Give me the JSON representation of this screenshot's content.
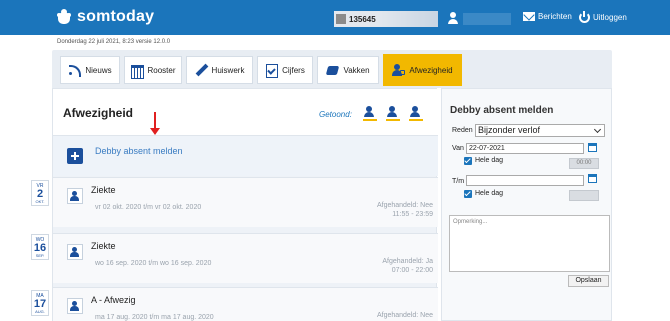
{
  "app": {
    "brand": "somtoday"
  },
  "topbar": {
    "student_number": "135645",
    "messages_label": "Berichten",
    "logout_label": "Uitloggen",
    "icons": {
      "messages": "envelope-icon",
      "logout": "power-icon",
      "user": "user-icon"
    }
  },
  "dateline": "Donderdag 22 juli 2021, 8:23 versie 12.0.0",
  "tabs": [
    {
      "label": "Nieuws",
      "icon": "rss-icon"
    },
    {
      "label": "Rooster",
      "icon": "calendar-icon"
    },
    {
      "label": "Huiswerk",
      "icon": "pen-icon"
    },
    {
      "label": "Cijfers",
      "icon": "checklist-icon"
    },
    {
      "label": "Vakken",
      "icon": "books-icon"
    },
    {
      "label": "Afwezigheid",
      "icon": "person-badge-icon",
      "active": true
    }
  ],
  "main": {
    "title": "Afwezigheid",
    "filter_label": "Getoond:",
    "add_label": "Debby absent melden",
    "items": [
      {
        "title": "Ziekte",
        "period": "vr 02 okt. 2020 t/m vr 02 okt. 2020",
        "status": "Afgehandeld: Nee",
        "time": "11:55 - 23:59",
        "date": {
          "dow": "VR",
          "day": "2",
          "mon": "OKT."
        }
      },
      {
        "title": "Ziekte",
        "period": "wo 16 sep. 2020 t/m wo 16 sep. 2020",
        "status": "Afgehandeld: Ja",
        "time": "07:00 - 22:00",
        "date": {
          "dow": "WO",
          "day": "16",
          "mon": "SEP."
        }
      },
      {
        "title": "A - Afwezig",
        "period": "ma 17 aug. 2020 t/m ma 17 aug. 2020",
        "status": "Afgehandeld: Nee",
        "time": "",
        "date": {
          "dow": "MA",
          "day": "17",
          "mon": "AUG."
        }
      }
    ]
  },
  "side": {
    "title": "Debby absent melden",
    "reason_label": "Reden",
    "reason_value": "Bijzonder verlof",
    "from_label": "Van",
    "from_value": "22-07-2021",
    "whole_day_label": "Hele dag",
    "from_time": "00:00",
    "to_label": "T/m",
    "to_value": "",
    "to_whole_day_label": "Hele dag",
    "remark_placeholder": "Opmerking...",
    "save_label": "Opslaan"
  },
  "colors": {
    "brand_blue": "#1b75bb",
    "accent_yellow": "#f2b800",
    "arrow_red": "#e02020"
  }
}
